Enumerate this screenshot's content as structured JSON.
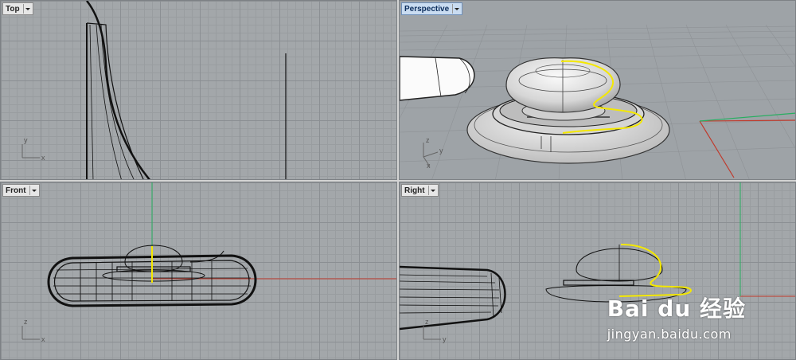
{
  "viewports": {
    "top": {
      "label": "Top",
      "axis_x": "x",
      "axis_y": "y"
    },
    "perspective": {
      "label": "Perspective",
      "axis_x": "x",
      "axis_y": "y",
      "axis_z": "z"
    },
    "front": {
      "label": "Front",
      "axis_x": "x",
      "axis_y": "z"
    },
    "right": {
      "label": "Right",
      "axis_x": "y",
      "axis_y": "z"
    }
  },
  "colors": {
    "viewport_bg": "#a3a7aa",
    "active_tab": "#c9dcf1",
    "x_axis": "#c0392b",
    "y_axis": "#27ae60",
    "highlight_curve": "#f4e800"
  },
  "watermark": {
    "brand": "Bai du 经验",
    "url": "jingyan.baidu.com"
  }
}
